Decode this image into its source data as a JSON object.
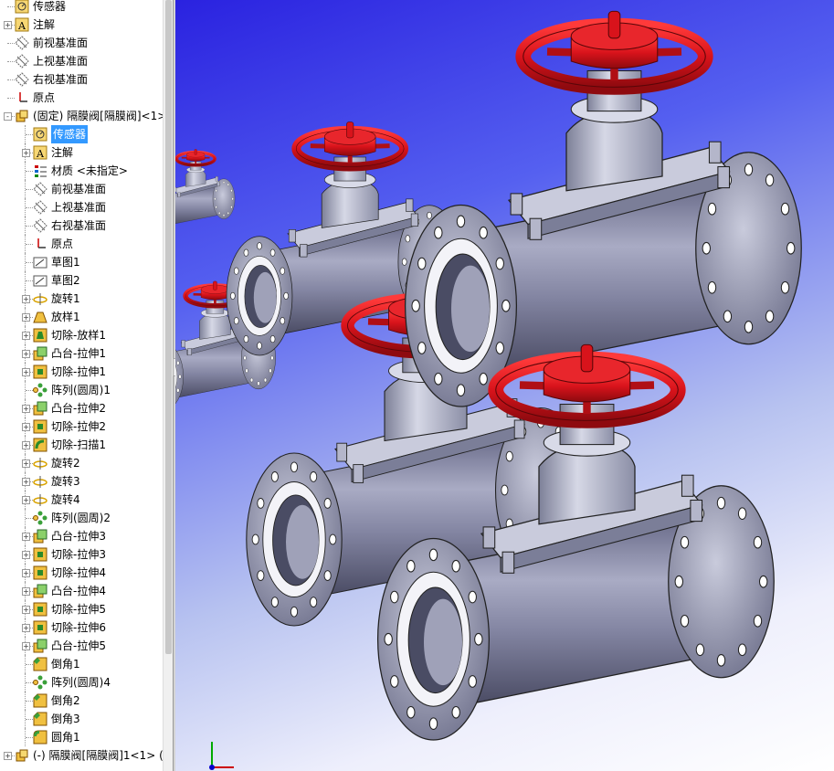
{
  "tree": {
    "items": [
      {
        "label": "传感器",
        "icon": "sensor-icon",
        "level": 0,
        "expander": "",
        "selected": false
      },
      {
        "label": "注解",
        "icon": "annotation-icon",
        "level": 0,
        "expander": "+",
        "selected": false
      },
      {
        "label": "前视基准面",
        "icon": "plane-icon",
        "level": 0,
        "expander": "",
        "selected": false
      },
      {
        "label": "上视基准面",
        "icon": "plane-icon",
        "level": 0,
        "expander": "",
        "selected": false
      },
      {
        "label": "右视基准面",
        "icon": "plane-icon",
        "level": 0,
        "expander": "",
        "selected": false
      },
      {
        "label": "原点",
        "icon": "origin-icon",
        "level": 0,
        "expander": "",
        "selected": false
      },
      {
        "label": "(固定) 隔膜阀[隔膜阀]<1>",
        "icon": "part-icon",
        "level": 0,
        "expander": "-",
        "selected": false
      },
      {
        "label": "传感器",
        "icon": "sensor-icon",
        "level": 1,
        "expander": "",
        "selected": true
      },
      {
        "label": "注解",
        "icon": "annotation-icon",
        "level": 1,
        "expander": "+",
        "selected": false
      },
      {
        "label": "材质 <未指定>",
        "icon": "material-icon",
        "level": 1,
        "expander": "",
        "selected": false
      },
      {
        "label": "前视基准面",
        "icon": "plane-icon",
        "level": 1,
        "expander": "",
        "selected": false
      },
      {
        "label": "上视基准面",
        "icon": "plane-icon",
        "level": 1,
        "expander": "",
        "selected": false
      },
      {
        "label": "右视基准面",
        "icon": "plane-icon",
        "level": 1,
        "expander": "",
        "selected": false
      },
      {
        "label": "原点",
        "icon": "origin-icon",
        "level": 1,
        "expander": "",
        "selected": false
      },
      {
        "label": "草图1",
        "icon": "sketch-icon",
        "level": 1,
        "expander": "",
        "selected": false
      },
      {
        "label": "草图2",
        "icon": "sketch-icon",
        "level": 1,
        "expander": "",
        "selected": false
      },
      {
        "label": "旋转1",
        "icon": "revolve-icon",
        "level": 1,
        "expander": "+",
        "selected": false
      },
      {
        "label": "放样1",
        "icon": "loft-icon",
        "level": 1,
        "expander": "+",
        "selected": false
      },
      {
        "label": "切除-放样1",
        "icon": "cut-loft-icon",
        "level": 1,
        "expander": "+",
        "selected": false
      },
      {
        "label": "凸台-拉伸1",
        "icon": "boss-extrude-icon",
        "level": 1,
        "expander": "+",
        "selected": false
      },
      {
        "label": "切除-拉伸1",
        "icon": "cut-extrude-icon",
        "level": 1,
        "expander": "+",
        "selected": false
      },
      {
        "label": "阵列(圆周)1",
        "icon": "circular-pattern-icon",
        "level": 1,
        "expander": "",
        "selected": false
      },
      {
        "label": "凸台-拉伸2",
        "icon": "boss-extrude-icon",
        "level": 1,
        "expander": "+",
        "selected": false
      },
      {
        "label": "切除-拉伸2",
        "icon": "cut-extrude-icon",
        "level": 1,
        "expander": "+",
        "selected": false
      },
      {
        "label": "切除-扫描1",
        "icon": "cut-sweep-icon",
        "level": 1,
        "expander": "+",
        "selected": false
      },
      {
        "label": "旋转2",
        "icon": "revolve-icon",
        "level": 1,
        "expander": "+",
        "selected": false
      },
      {
        "label": "旋转3",
        "icon": "revolve-icon",
        "level": 1,
        "expander": "+",
        "selected": false
      },
      {
        "label": "旋转4",
        "icon": "revolve-icon",
        "level": 1,
        "expander": "+",
        "selected": false
      },
      {
        "label": "阵列(圆周)2",
        "icon": "circular-pattern-icon",
        "level": 1,
        "expander": "",
        "selected": false
      },
      {
        "label": "凸台-拉伸3",
        "icon": "boss-extrude-icon",
        "level": 1,
        "expander": "+",
        "selected": false
      },
      {
        "label": "切除-拉伸3",
        "icon": "cut-extrude-icon",
        "level": 1,
        "expander": "+",
        "selected": false
      },
      {
        "label": "切除-拉伸4",
        "icon": "cut-extrude-icon",
        "level": 1,
        "expander": "+",
        "selected": false
      },
      {
        "label": "凸台-拉伸4",
        "icon": "boss-extrude-icon",
        "level": 1,
        "expander": "+",
        "selected": false
      },
      {
        "label": "切除-拉伸5",
        "icon": "cut-extrude-icon",
        "level": 1,
        "expander": "+",
        "selected": false
      },
      {
        "label": "切除-拉伸6",
        "icon": "cut-extrude-icon",
        "level": 1,
        "expander": "+",
        "selected": false
      },
      {
        "label": "凸台-拉伸5",
        "icon": "boss-extrude-icon",
        "level": 1,
        "expander": "+",
        "selected": false
      },
      {
        "label": "倒角1",
        "icon": "chamfer-icon",
        "level": 1,
        "expander": "",
        "selected": false
      },
      {
        "label": "阵列(圆周)4",
        "icon": "circular-pattern-icon",
        "level": 1,
        "expander": "",
        "selected": false
      },
      {
        "label": "倒角2",
        "icon": "chamfer-icon",
        "level": 1,
        "expander": "",
        "selected": false
      },
      {
        "label": "倒角3",
        "icon": "chamfer-icon",
        "level": 1,
        "expander": "",
        "selected": false
      },
      {
        "label": "圆角1",
        "icon": "fillet-icon",
        "level": 1,
        "expander": "",
        "selected": false
      },
      {
        "label": "(-) 隔膜阀[隔膜阀]1<1> (",
        "icon": "part-icon",
        "level": 0,
        "expander": "+",
        "selected": false
      }
    ]
  },
  "colors": {
    "handwheel": "#d8131b",
    "handwheel_dark": "#8e0a0f",
    "body_metal": "#8a8da8",
    "body_dark": "#4f5068",
    "bonnet": "#b9bcd0",
    "selected": "#3399ff",
    "sky_top": "#2a22e0"
  }
}
